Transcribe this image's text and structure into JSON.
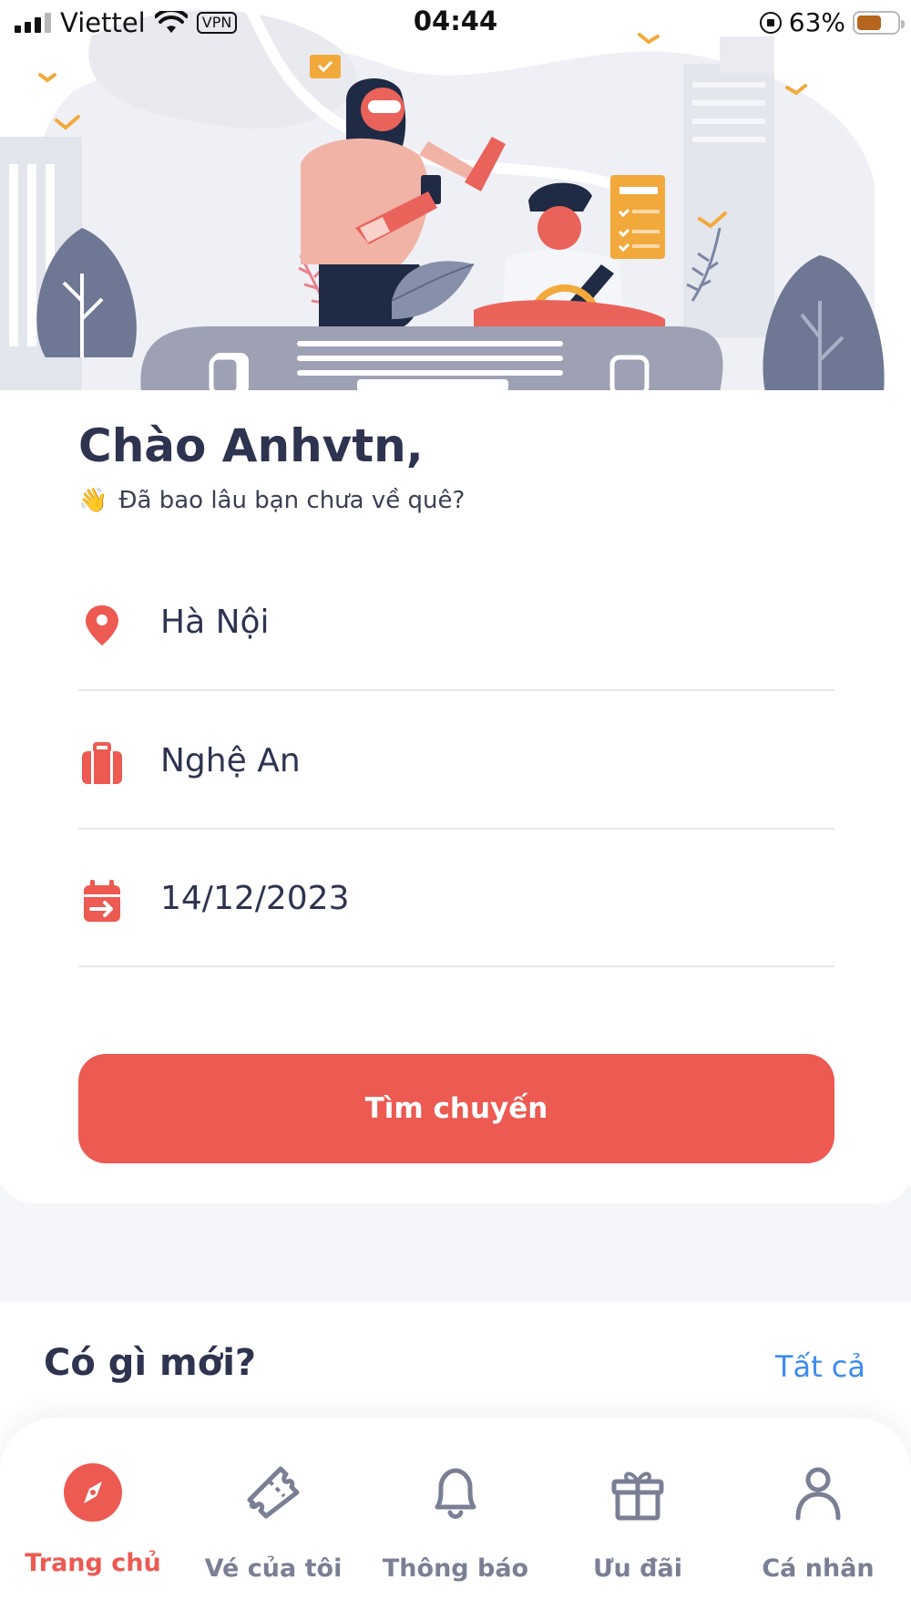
{
  "status_bar": {
    "carrier": "Viettel",
    "vpn": "VPN",
    "time": "04:44",
    "battery_percent": "63%",
    "battery_level": 0.63
  },
  "greeting": {
    "title": "Chào Anhvtn,",
    "emoji": "👋",
    "subtitle": "Đã bao lâu bạn chưa về quê?"
  },
  "form": {
    "from": {
      "icon": "location-pin-icon",
      "value": "Hà Nội"
    },
    "to": {
      "icon": "luggage-icon",
      "value": "Nghệ An"
    },
    "date": {
      "icon": "calendar-icon",
      "value": "14/12/2023"
    },
    "search_label": "Tìm chuyến"
  },
  "news": {
    "title": "Có gì mới?",
    "see_all": "Tất cả"
  },
  "bottom_nav": {
    "items": [
      {
        "label": "Trang chủ",
        "icon": "compass-icon",
        "active": true
      },
      {
        "label": "Vé của tôi",
        "icon": "ticket-icon",
        "active": false
      },
      {
        "label": "Thông báo",
        "icon": "bell-icon",
        "active": false
      },
      {
        "label": "Ưu đãi",
        "icon": "gift-icon",
        "active": false
      },
      {
        "label": "Cá nhân",
        "icon": "user-icon",
        "active": false
      }
    ]
  },
  "colors": {
    "accent": "#ec5a52",
    "text": "#2e3350",
    "link": "#3d8bf0",
    "inactive": "#7a7f95"
  }
}
